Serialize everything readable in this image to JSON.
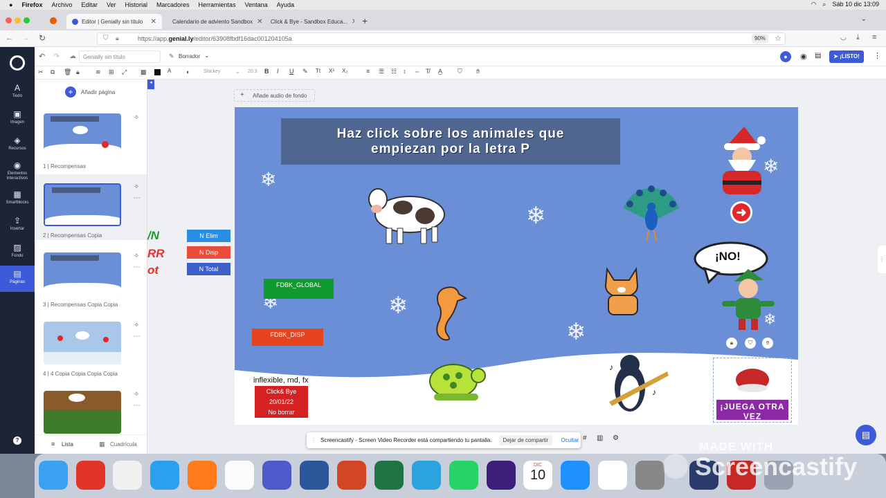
{
  "menubar": {
    "app": "Firefox",
    "items": [
      "Archivo",
      "Editar",
      "Ver",
      "Historial",
      "Marcadores",
      "Herramientas",
      "Ventana",
      "Ayuda"
    ],
    "clock": "Sáb 10 dic  13:09"
  },
  "tabs": [
    {
      "label": "Editor | Genially sin título"
    },
    {
      "label": "Calendario de adviento Sandbox"
    },
    {
      "label": "Click & Bye - Sandbox Educa..."
    }
  ],
  "url": {
    "prefix": "https://app.",
    "domain": "genial.ly",
    "path": "/editor/63908fbdf16dac001204105a",
    "zoom": "90%"
  },
  "app": {
    "title_placeholder": "Genially sin título",
    "draft": "Borrador",
    "listo": "¡LISTO!",
    "font_name": "Slackey",
    "font_size": "20.3"
  },
  "leftnav": [
    {
      "icon": "A",
      "label": "Texto"
    },
    {
      "icon": "▣",
      "label": "Imagen"
    },
    {
      "icon": "◈",
      "label": "Recursos"
    },
    {
      "icon": "◉",
      "label": "Elementos interactivos"
    },
    {
      "icon": "▦",
      "label": "Smartblocks"
    },
    {
      "icon": "⇪",
      "label": "Insertar"
    },
    {
      "icon": "▨",
      "label": "Fondo"
    },
    {
      "icon": "▤",
      "label": "Páginas"
    }
  ],
  "pages": {
    "add_label": "Añadir página",
    "items": [
      {
        "label": "1 |  Recompensas"
      },
      {
        "label": "2 |  Recompensas Copia"
      },
      {
        "label": "3 |  Recompensas Copia Copia"
      },
      {
        "label": "4 |  4 Copia Copia Copia Copia"
      }
    ],
    "view_list": "Lista",
    "view_grid": "Cuadrícula"
  },
  "canvas": {
    "add_audio": "Añade audio de fondo",
    "offslide_texts": [
      "/N",
      "RR",
      "ot"
    ],
    "n_elim": "N Elim",
    "n_disp": "N Disp",
    "n_total": "N Total"
  },
  "slide": {
    "title_line1": "Haz click sobre los animales que",
    "title_line2": "empiezan por la letra P",
    "fdbk_global": "FDBK_GLOBAL",
    "fdbk_disp": "FDBK_DISP",
    "inflexible": "inflexible, rnd, fx",
    "note_line1": "Click& Bye",
    "note_line2": "20/01/22",
    "note_line3": "No borrar",
    "bubble": "¡NO!",
    "juega_line1": "¡JUEGA OTRA",
    "juega_line2": "VEZ"
  },
  "screencastify": {
    "message": "Screencastify - Screen Video Recorder está compartiendo tu pantalla.",
    "stop": "Dejar de compartir",
    "hide": "Ocultar",
    "watermark_small": "MADE WITH",
    "watermark_big": "Screencastify"
  },
  "dock": {
    "calendar_month": "DIC",
    "calendar_day": "10"
  },
  "colors": {
    "accent": "#3d5bd9",
    "slide_bg": "#6b8fd6",
    "nav_bg": "#1d2438",
    "green": "#0f9a2e",
    "red": "#e9421f"
  }
}
